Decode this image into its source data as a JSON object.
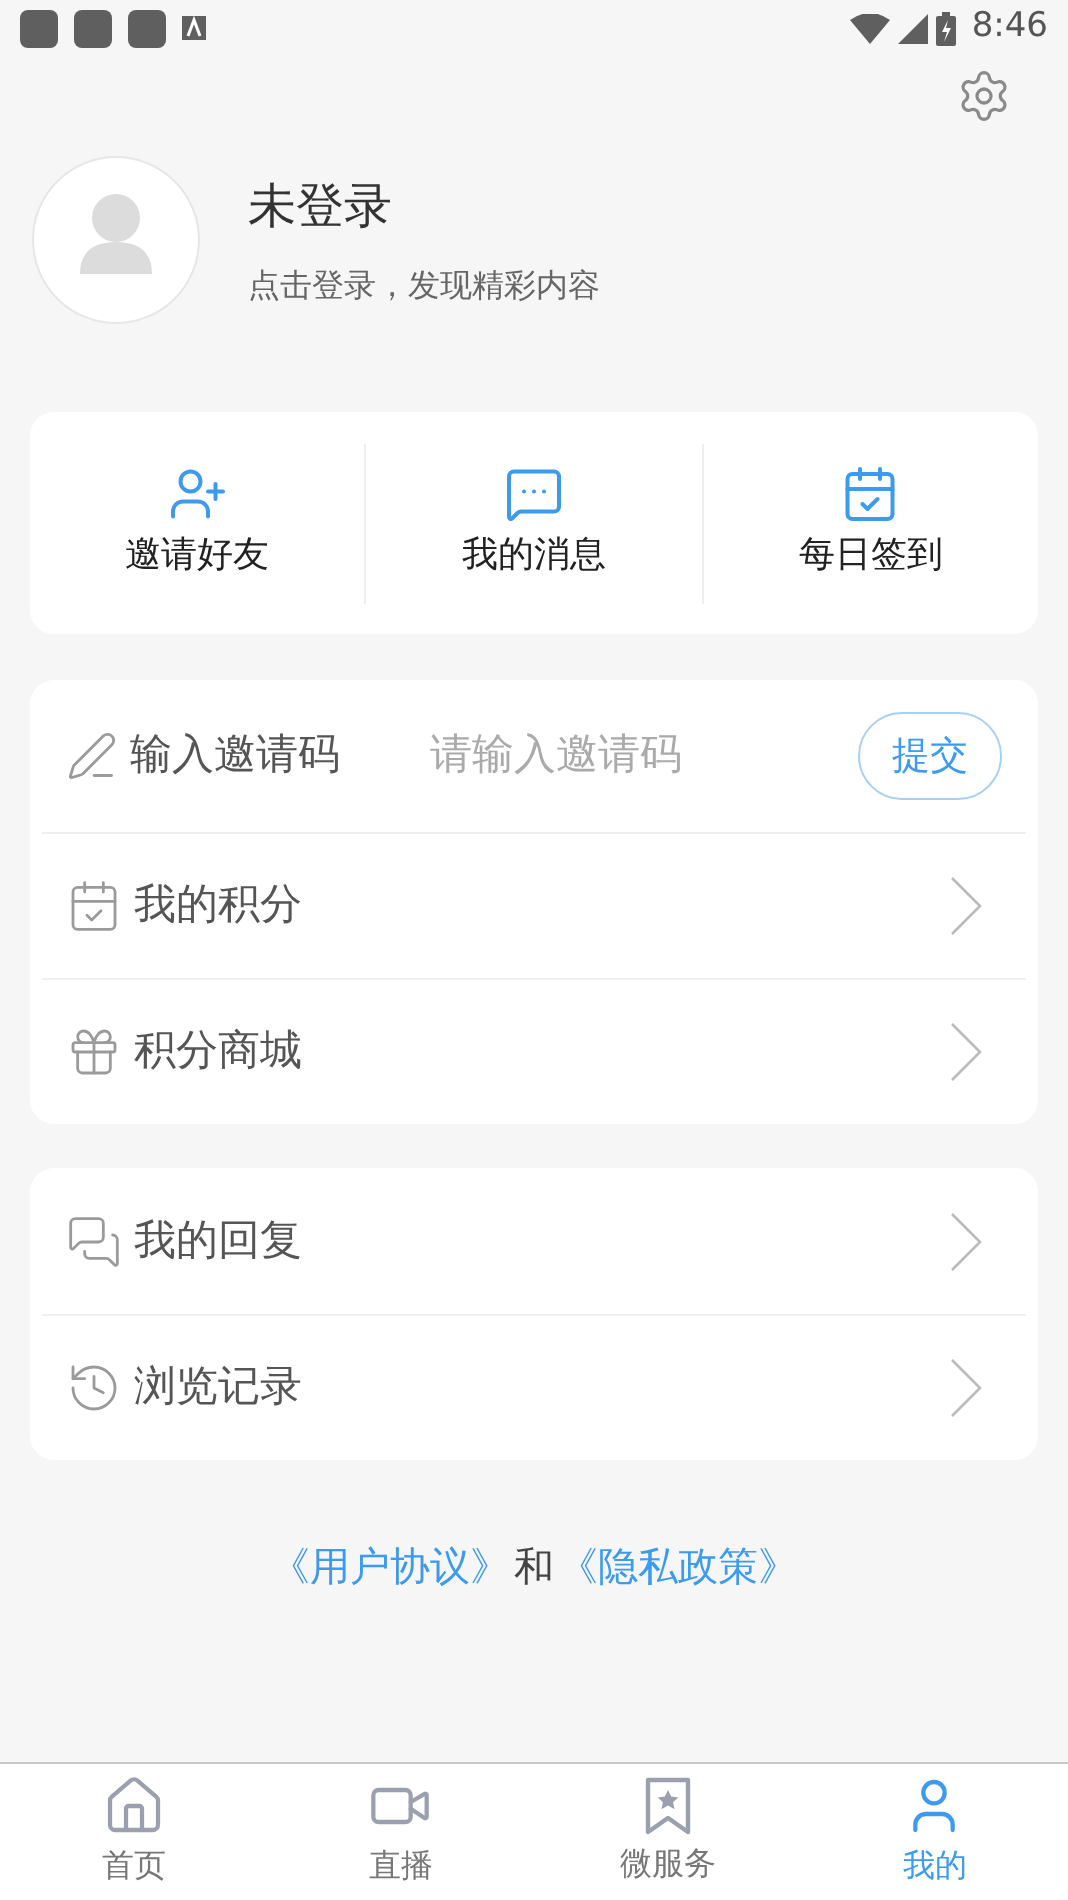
{
  "status_bar": {
    "time": "8:46"
  },
  "profile": {
    "name": "未登录",
    "hint": "点击登录，发现精彩内容"
  },
  "shortcuts": [
    {
      "label": "邀请好友"
    },
    {
      "label": "我的消息"
    },
    {
      "label": "每日签到"
    }
  ],
  "menu_groups": [
    {
      "rows": [
        {
          "kind": "input",
          "label": "输入邀请码",
          "placeholder": "请输入邀请码",
          "button": "提交"
        },
        {
          "kind": "link",
          "label": "我的积分"
        },
        {
          "kind": "link",
          "label": "积分商城"
        }
      ]
    },
    {
      "rows": [
        {
          "kind": "link",
          "label": "我的回复"
        },
        {
          "kind": "link",
          "label": "浏览记录"
        }
      ]
    }
  ],
  "agreement": {
    "link_1": "《用户协议》",
    "joiner": "和",
    "link_2": "《隐私政策》"
  },
  "tab_bar": [
    {
      "label": "首页",
      "selected": false
    },
    {
      "label": "直播",
      "selected": false
    },
    {
      "label": "微服务",
      "selected": false
    },
    {
      "label": "我的",
      "selected": true
    }
  ]
}
